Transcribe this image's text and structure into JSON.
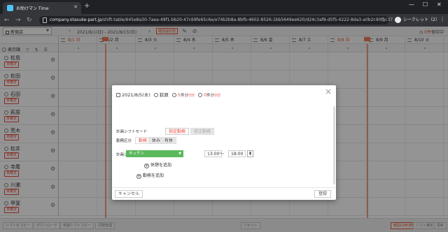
{
  "browser": {
    "tab_title": "お助けマン Time",
    "url_domain": "company.otasuke-part.jp",
    "url_path": "/shift-table/645e8a30-7aea-49f1-bb20-47c69fe65c6e/e74b2b8a-8bfb-4602-8526-1bb5649ee620/d24c3af8-d5f5-4222-8da3-a0b2c90f1c37",
    "incognito_label": "シークレット（2）"
  },
  "toolbar": {
    "site_name": "新宿店",
    "date_range": "2021/8/1(日) - 2021/8/15(日)",
    "publish_button": "確認届切替",
    "pending_label": "0件",
    "pending_suffix": "保存中"
  },
  "list_header": {
    "label": "表示順",
    "filter_icon": "filter-icon",
    "sort_icon": "sort-icon",
    "menu_icon": "menu-icon"
  },
  "days": [
    {
      "label": "8/1 日",
      "highlight": true
    },
    {
      "label": "8/2 月",
      "highlight": false
    },
    {
      "label": "8/3 火",
      "highlight": false
    },
    {
      "label": "8/4 水",
      "highlight": false
    },
    {
      "label": "8/5 木",
      "highlight": false
    },
    {
      "label": "8/6 金",
      "highlight": false
    },
    {
      "label": "8/7 土",
      "highlight": false
    },
    {
      "label": "8/8 日",
      "highlight": true
    },
    {
      "label": "8/9 月",
      "highlight": false
    },
    {
      "label": "8/10 火",
      "highlight": false
    }
  ],
  "employees": [
    {
      "name": "松島",
      "badge": "未確定"
    },
    {
      "name": "松田",
      "badge": "未確定"
    },
    {
      "name": "石田",
      "badge": "未確定"
    },
    {
      "name": "萩原",
      "badge": "未確定"
    },
    {
      "name": "荒木",
      "badge": "未確定"
    },
    {
      "name": "松井",
      "badge": "未確定"
    },
    {
      "name": "寺尾",
      "badge": "未確定"
    },
    {
      "name": "川瀬",
      "badge": "未確定"
    },
    {
      "name": "甲斐",
      "badge": "未確定"
    }
  ],
  "footer": {
    "buttons": [
      "シフトをコピー",
      "ダウンロード",
      "希望シフトコピー",
      "労務管理"
    ],
    "center_button": "リセット",
    "right_buttons": [
      "確認LINE通知",
      "シフト確定",
      "更新"
    ]
  },
  "modal": {
    "date": "2021/8/5(木)",
    "employee": "萩原",
    "work_days": "5",
    "work_days_unit": "件分",
    "work_days_suffix": "0分",
    "break_count": "0",
    "break_unit": "件分",
    "break_suffix": "0分",
    "mode_label": "計画シフトモード",
    "mode_on": "指定勤務",
    "mode_off": "修正勤務",
    "type_label": "勤務区分",
    "type_options": [
      "勤務",
      "休み",
      "有休"
    ],
    "shift_label": "計画シフト",
    "shift_value": "キッチン",
    "start_time": "13:00",
    "time_sep": "〜",
    "end_time": "18:00",
    "add_break": "休憩を追加",
    "add_work": "勤務を追加",
    "cancel": "キャンセル",
    "save": "登録"
  },
  "colors": {
    "accent": "#ea5b37",
    "shift_green": "#5cb85c",
    "badge_red": "#e74c3c"
  }
}
